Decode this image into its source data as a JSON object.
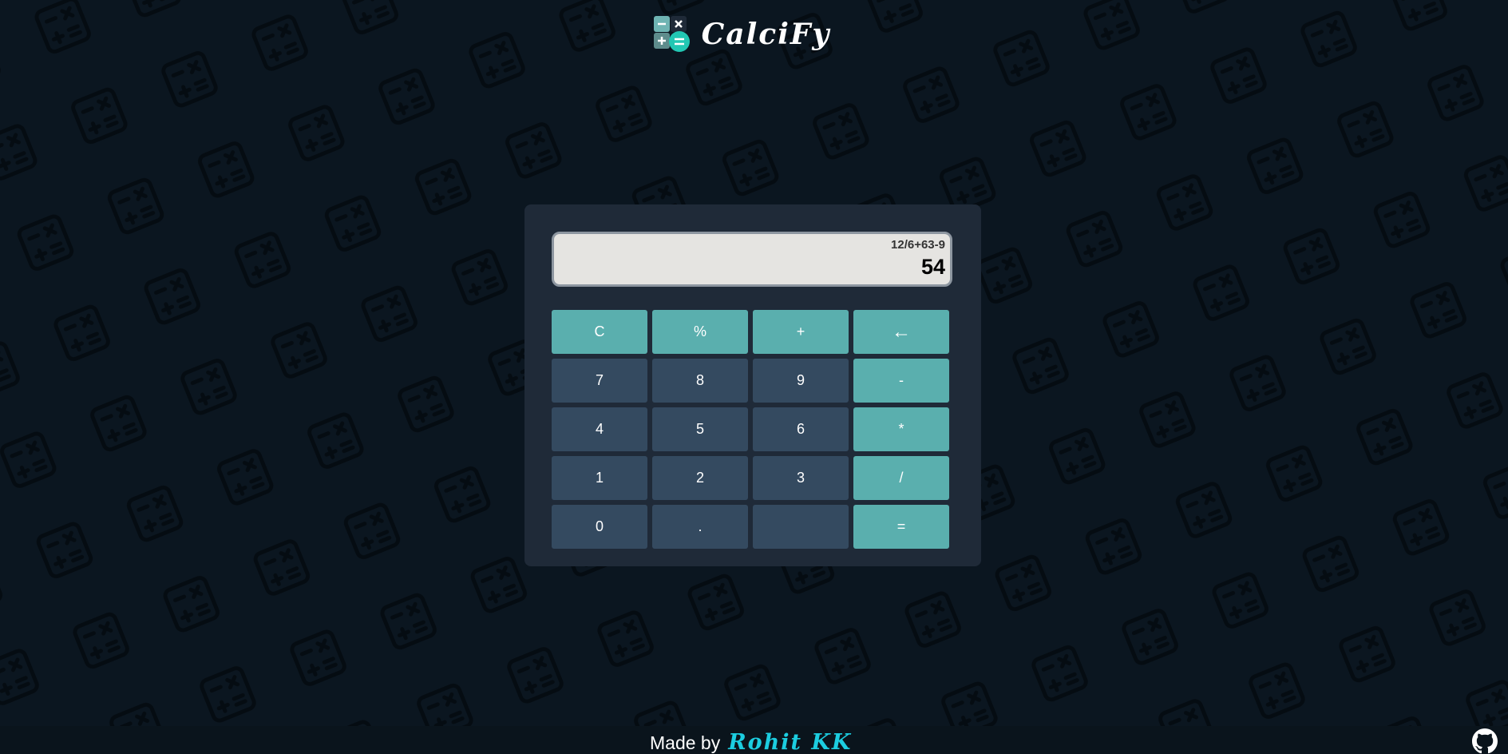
{
  "header": {
    "title": "CalciFy",
    "logo_icon": "calculator-logo-icon"
  },
  "display": {
    "expression": "12/6+63-9",
    "result": "54"
  },
  "keys": [
    {
      "label": "C",
      "name": "clear-button",
      "kind": "accent"
    },
    {
      "label": "%",
      "name": "percent-button",
      "kind": "accent"
    },
    {
      "label": "+",
      "name": "add-button",
      "kind": "accent"
    },
    {
      "label": "←",
      "name": "backspace-button",
      "kind": "accent"
    },
    {
      "label": "7",
      "name": "digit-7-button",
      "kind": "num"
    },
    {
      "label": "8",
      "name": "digit-8-button",
      "kind": "num"
    },
    {
      "label": "9",
      "name": "digit-9-button",
      "kind": "num"
    },
    {
      "label": "-",
      "name": "subtract-button",
      "kind": "accent"
    },
    {
      "label": "4",
      "name": "digit-4-button",
      "kind": "num"
    },
    {
      "label": "5",
      "name": "digit-5-button",
      "kind": "num"
    },
    {
      "label": "6",
      "name": "digit-6-button",
      "kind": "num"
    },
    {
      "label": "*",
      "name": "multiply-button",
      "kind": "accent"
    },
    {
      "label": "1",
      "name": "digit-1-button",
      "kind": "num"
    },
    {
      "label": "2",
      "name": "digit-2-button",
      "kind": "num"
    },
    {
      "label": "3",
      "name": "digit-3-button",
      "kind": "num"
    },
    {
      "label": "/",
      "name": "divide-button",
      "kind": "accent"
    },
    {
      "label": "0",
      "name": "digit-0-button",
      "kind": "num"
    },
    {
      "label": ".",
      "name": "decimal-button",
      "kind": "num"
    },
    {
      "label": "",
      "name": "blank-button",
      "kind": "num"
    },
    {
      "label": "=",
      "name": "equals-button",
      "kind": "accent"
    }
  ],
  "footer": {
    "made_by": "Made by",
    "author": "Rohit KK",
    "github_icon": "github-icon"
  },
  "colors": {
    "background": "#0b1620",
    "panel": "#1f2a38",
    "accent_key": "#5aafae",
    "number_key": "#344a60",
    "author": "#1ccde0"
  }
}
